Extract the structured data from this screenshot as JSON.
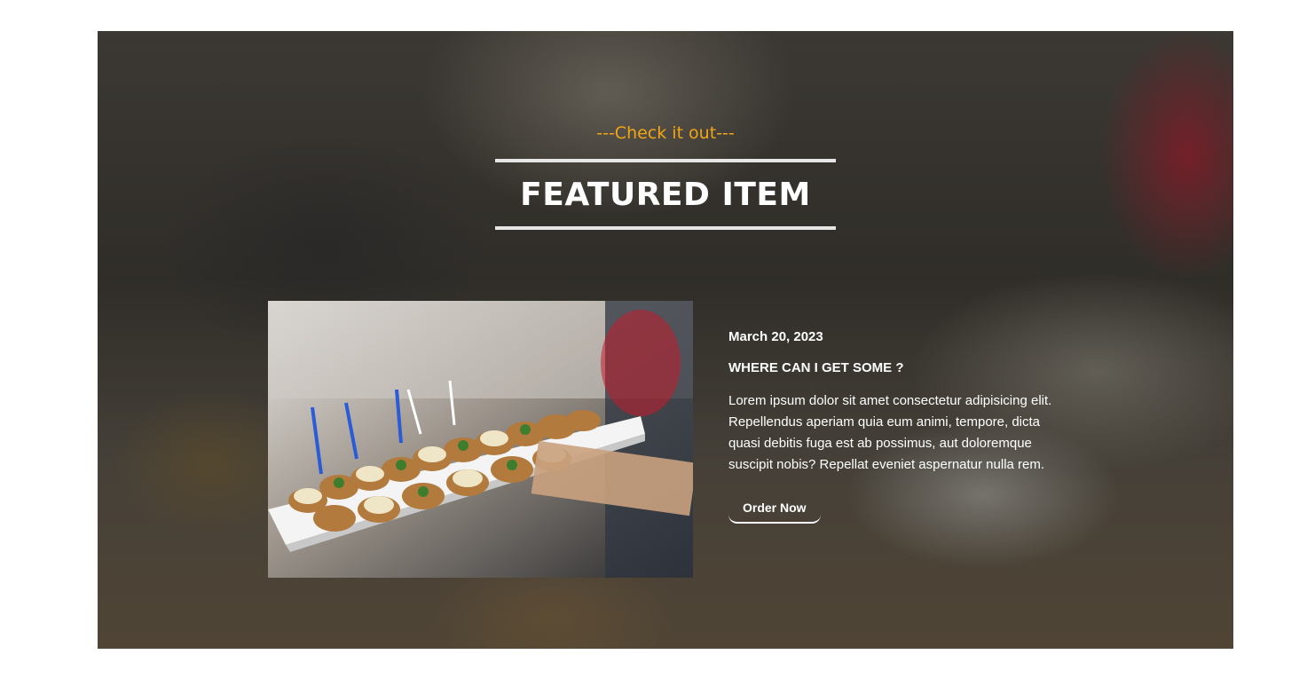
{
  "section": {
    "subtitle": "---Check it out---",
    "title": "FEATURED ITEM"
  },
  "featured": {
    "image_alt": "Tray of canapés held by a server",
    "date": "March 20, 2023",
    "heading": "WHERE CAN I GET SOME ?",
    "description": "Lorem ipsum dolor sit amet consectetur adipisicing elit. Repellendus aperiam quia eum animi, tempore, dicta quasi debitis fuga est ab possimus, aut doloremque suscipit nobis? Repellat eveniet aspernatur nulla rem.",
    "button_label": "Order Now"
  },
  "colors": {
    "accent": "#f2a516",
    "text": "#ffffff",
    "rule": "#e6e6e6"
  }
}
